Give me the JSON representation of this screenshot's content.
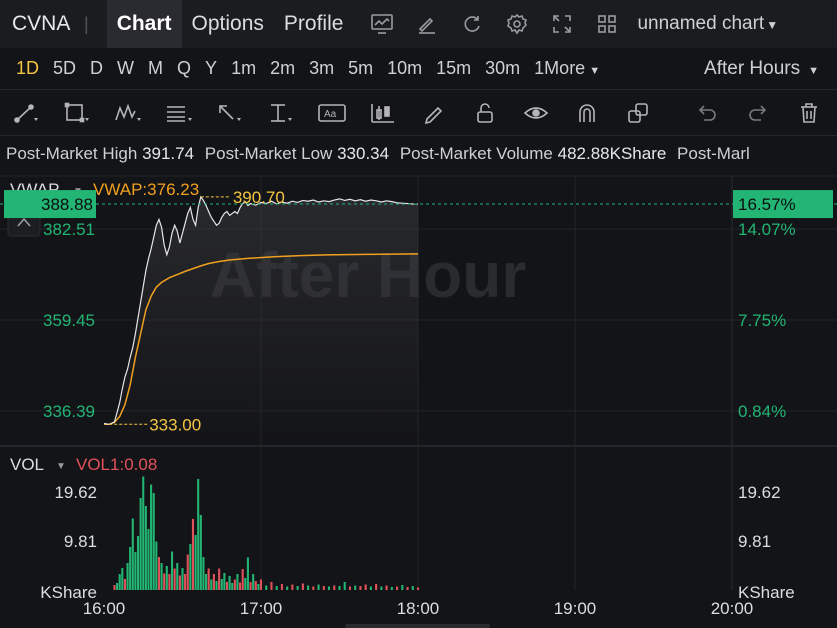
{
  "header": {
    "symbol": "CVNA",
    "tabs": [
      "Chart",
      "Options",
      "Profile"
    ],
    "active_tab": "Chart",
    "chart_name": "unnamed chart"
  },
  "timeframes": {
    "items": [
      "1D",
      "5D",
      "D",
      "W",
      "M",
      "Q",
      "Y",
      "1m",
      "2m",
      "3m",
      "5m",
      "10m",
      "15m",
      "30m",
      "1More"
    ],
    "active": "1D",
    "session": "After Hours"
  },
  "stats": {
    "high_label": "Post-Market High",
    "high_value": "391.74",
    "low_label": "Post-Market Low",
    "low_value": "330.34",
    "volume_label": "Post-Market Volume",
    "volume_value": "482.88KShare",
    "cut_label": "Post-Marl"
  },
  "price_panel": {
    "indicator": "VWAP",
    "indicator_value": "VWAP:376.23",
    "watermark": "After Hour",
    "current_price": "388.88",
    "current_pct": "16.57%",
    "left_ticks": [
      "382.51",
      "359.45",
      "336.39"
    ],
    "right_ticks": [
      "14.07%",
      "7.75%",
      "0.84%"
    ],
    "high_marker": "390.70",
    "low_marker": "333.00"
  },
  "volume_panel": {
    "indicator": "VOL",
    "indicator_value": "VOL1:0.08",
    "ticks": [
      "19.62",
      "9.81"
    ],
    "unit": "KShare"
  },
  "x_axis": [
    "16:00",
    "17:00",
    "18:00",
    "19:00",
    "20:00"
  ],
  "colors": {
    "up": "#22b573",
    "down": "#e0525a",
    "vwap": "#f0a020",
    "accent": "#f5c542",
    "price_line": "#e6e6e6"
  },
  "chart_data": {
    "type": "line",
    "x_range": [
      "16:00",
      "20:00"
    ],
    "price": {
      "ylim": [
        328,
        396
      ],
      "values": [
        [
          0,
          333.2
        ],
        [
          2,
          333.0
        ],
        [
          4,
          333.6
        ],
        [
          5,
          336.0
        ],
        [
          6,
          338.5
        ],
        [
          7,
          342.0
        ],
        [
          8,
          345.0
        ],
        [
          9,
          347.0
        ],
        [
          10,
          350.0
        ],
        [
          11,
          352.5
        ],
        [
          12,
          356.0
        ],
        [
          13,
          360.0
        ],
        [
          14,
          364.0
        ],
        [
          15,
          368.0
        ],
        [
          16,
          372.0
        ],
        [
          17,
          375.0
        ],
        [
          18,
          377.5
        ],
        [
          19,
          380.5
        ],
        [
          20,
          383.5
        ],
        [
          21,
          385.0
        ],
        [
          22,
          383.0
        ],
        [
          23,
          378.5
        ],
        [
          24,
          376.0
        ],
        [
          25,
          378.0
        ],
        [
          26,
          381.5
        ],
        [
          27,
          383.5
        ],
        [
          28,
          382.0
        ],
        [
          29,
          379.0
        ],
        [
          30,
          381.5
        ],
        [
          31,
          384.0
        ],
        [
          32,
          386.5
        ],
        [
          33,
          388.0
        ],
        [
          34,
          385.0
        ],
        [
          35,
          383.5
        ],
        [
          36,
          388.0
        ],
        [
          37,
          390.7
        ],
        [
          38,
          389.8
        ],
        [
          39,
          388.5
        ],
        [
          40,
          387.0
        ],
        [
          41,
          385.5
        ],
        [
          42,
          384.5
        ],
        [
          43,
          383.5
        ],
        [
          44,
          384.0
        ],
        [
          45,
          385.5
        ],
        [
          46,
          386.5
        ],
        [
          47,
          387.0
        ],
        [
          48,
          386.0
        ],
        [
          49,
          386.5
        ],
        [
          50,
          387.0
        ],
        [
          51,
          386.5
        ],
        [
          52,
          388.0
        ],
        [
          53,
          389.0
        ],
        [
          54,
          389.5
        ],
        [
          55,
          388.5
        ],
        [
          56,
          389.0
        ],
        [
          58,
          388.6
        ],
        [
          60,
          389.3
        ],
        [
          62,
          389.0
        ],
        [
          64,
          389.6
        ],
        [
          66,
          388.9
        ],
        [
          68,
          389.4
        ],
        [
          70,
          389.1
        ],
        [
          72,
          389.6
        ],
        [
          74,
          389.3
        ],
        [
          76,
          389.8
        ],
        [
          78,
          389.6
        ],
        [
          80,
          389.9
        ],
        [
          82,
          389.4
        ],
        [
          84,
          389.7
        ],
        [
          86,
          389.5
        ],
        [
          88,
          389.9
        ],
        [
          90,
          390.2
        ],
        [
          92,
          389.8
        ],
        [
          94,
          390.1
        ],
        [
          96,
          389.7
        ],
        [
          98,
          390.0
        ],
        [
          100,
          389.6
        ],
        [
          102,
          389.9
        ],
        [
          104,
          389.7
        ],
        [
          106,
          389.4
        ],
        [
          108,
          389.7
        ],
        [
          110,
          389.5
        ],
        [
          112,
          389.2
        ],
        [
          114,
          389.1
        ],
        [
          116,
          389.0
        ],
        [
          118,
          388.9
        ],
        [
          120,
          388.88
        ]
      ],
      "vwap": [
        [
          0,
          333.0
        ],
        [
          2,
          333.0
        ],
        [
          4,
          333.5
        ],
        [
          6,
          335.0
        ],
        [
          8,
          338.0
        ],
        [
          10,
          343.0
        ],
        [
          12,
          350.0
        ],
        [
          14,
          356.0
        ],
        [
          16,
          362.0
        ],
        [
          18,
          365.5
        ],
        [
          20,
          367.8
        ],
        [
          22,
          369.0
        ],
        [
          25,
          370.2
        ],
        [
          28,
          371.0
        ],
        [
          31,
          371.8
        ],
        [
          34,
          372.5
        ],
        [
          37,
          373.2
        ],
        [
          40,
          373.8
        ],
        [
          44,
          374.3
        ],
        [
          48,
          374.7
        ],
        [
          55,
          375.1
        ],
        [
          65,
          375.5
        ],
        [
          75,
          375.8
        ],
        [
          85,
          376.0
        ],
        [
          100,
          376.1
        ],
        [
          120,
          376.23
        ]
      ]
    },
    "volume": {
      "ylim": [
        0,
        28
      ],
      "bars": [
        [
          4,
          1.0,
          0
        ],
        [
          5,
          1.4,
          1
        ],
        [
          6,
          3.2,
          1
        ],
        [
          7,
          4.4,
          1
        ],
        [
          8,
          2.2,
          0
        ],
        [
          9,
          5.4,
          1
        ],
        [
          10,
          8.6,
          1
        ],
        [
          11,
          14.3,
          1
        ],
        [
          12,
          7.6,
          1
        ],
        [
          13,
          10.8,
          1
        ],
        [
          14,
          18.4,
          1
        ],
        [
          15,
          22.7,
          1
        ],
        [
          16,
          16.8,
          1
        ],
        [
          17,
          12.2,
          1
        ],
        [
          18,
          21.1,
          1
        ],
        [
          19,
          19.4,
          1
        ],
        [
          20,
          9.7,
          1
        ],
        [
          21,
          6.6,
          0
        ],
        [
          22,
          5.4,
          1
        ],
        [
          23,
          3.3,
          0
        ],
        [
          24,
          4.8,
          1
        ],
        [
          25,
          3.2,
          0
        ],
        [
          26,
          7.7,
          1
        ],
        [
          27,
          4.3,
          0
        ],
        [
          28,
          5.4,
          1
        ],
        [
          29,
          2.9,
          0
        ],
        [
          30,
          4.4,
          1
        ],
        [
          31,
          3.2,
          0
        ],
        [
          32,
          7.1,
          0
        ],
        [
          33,
          9.2,
          1
        ],
        [
          34,
          14.2,
          0
        ],
        [
          35,
          11.0,
          1
        ],
        [
          36,
          22.2,
          1
        ],
        [
          37,
          15.0,
          1
        ],
        [
          38,
          6.6,
          1
        ],
        [
          39,
          3.2,
          1
        ],
        [
          40,
          4.3,
          0
        ],
        [
          41,
          2.1,
          1
        ],
        [
          42,
          3.2,
          0
        ],
        [
          43,
          1.8,
          1
        ],
        [
          44,
          4.3,
          0
        ],
        [
          45,
          2.2,
          1
        ],
        [
          46,
          3.4,
          1
        ],
        [
          47,
          1.6,
          0
        ],
        [
          48,
          2.8,
          1
        ],
        [
          49,
          1.4,
          1
        ],
        [
          50,
          2.1,
          0
        ],
        [
          51,
          3.2,
          1
        ],
        [
          52,
          1.5,
          0
        ],
        [
          53,
          4.2,
          0
        ],
        [
          54,
          2.4,
          1
        ],
        [
          55,
          6.5,
          1
        ],
        [
          56,
          1.6,
          0
        ],
        [
          57,
          3.2,
          1
        ],
        [
          58,
          1.8,
          0
        ],
        [
          59,
          1.2,
          1
        ],
        [
          60,
          2.1,
          0
        ],
        [
          62,
          0.9,
          1
        ],
        [
          64,
          1.6,
          0
        ],
        [
          66,
          0.8,
          1
        ],
        [
          68,
          1.2,
          0
        ],
        [
          70,
          0.7,
          1
        ],
        [
          72,
          1.1,
          0
        ],
        [
          74,
          0.8,
          1
        ],
        [
          76,
          1.3,
          0
        ],
        [
          78,
          0.9,
          1
        ],
        [
          80,
          0.7,
          0
        ],
        [
          82,
          1.1,
          1
        ],
        [
          84,
          0.8,
          0
        ],
        [
          86,
          0.7,
          1
        ],
        [
          88,
          0.9,
          0
        ],
        [
          90,
          0.8,
          1
        ],
        [
          92,
          1.6,
          1
        ],
        [
          94,
          0.7,
          0
        ],
        [
          96,
          0.9,
          1
        ],
        [
          98,
          0.8,
          0
        ],
        [
          100,
          1.1,
          0
        ],
        [
          102,
          0.7,
          1
        ],
        [
          104,
          1.2,
          0
        ],
        [
          106,
          0.7,
          1
        ],
        [
          108,
          0.9,
          0
        ],
        [
          110,
          0.6,
          1
        ],
        [
          112,
          0.7,
          0
        ],
        [
          114,
          1.0,
          1
        ],
        [
          116,
          0.6,
          0
        ],
        [
          118,
          0.8,
          1
        ],
        [
          120,
          0.5,
          0
        ]
      ]
    }
  }
}
